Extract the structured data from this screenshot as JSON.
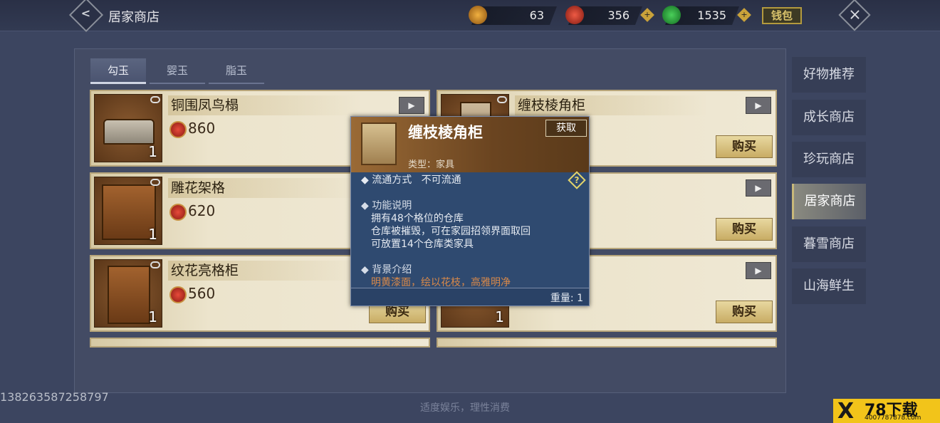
{
  "header": {
    "back_icon": "chevron-left-icon",
    "title": "居家商店",
    "currencies": [
      {
        "name": "gouyu",
        "icon": "gouyu-coin-icon",
        "value": "63",
        "color": "#c98a2a"
      },
      {
        "name": "yingyu",
        "icon": "red-jade-icon",
        "value": "356",
        "color": "#d24a3a"
      },
      {
        "name": "zhiyu",
        "icon": "green-jade-icon",
        "value": "1535",
        "color": "#3aa84a"
      }
    ],
    "wallet_label": "钱包",
    "close_icon": "close-icon"
  },
  "tabs": [
    {
      "label": "勾玉",
      "active": true
    },
    {
      "label": "婴玉",
      "active": false
    },
    {
      "label": "脂玉",
      "active": false
    }
  ],
  "items": [
    {
      "name": "铜围凤鸟榻",
      "price": "860",
      "count": "1",
      "buy_label": "购买"
    },
    {
      "name": "缠枝棱角柜",
      "price": "",
      "count": "",
      "buy_label": "购买"
    },
    {
      "name": "雕花架格",
      "price": "620",
      "count": "1",
      "buy_label": "购买"
    },
    {
      "name": "",
      "price": "",
      "count": "",
      "buy_label": "购买"
    },
    {
      "name": "纹花亮格柜",
      "price": "560",
      "count": "1",
      "buy_label": "购买"
    },
    {
      "name": "",
      "price": "",
      "count": "1",
      "buy_label": "购买"
    }
  ],
  "sidebar": [
    {
      "label": "好物推荐",
      "active": false
    },
    {
      "label": "成长商店",
      "active": false
    },
    {
      "label": "珍玩商店",
      "active": false
    },
    {
      "label": "居家商店",
      "active": true
    },
    {
      "label": "暮雪商店",
      "active": false
    },
    {
      "label": "山海鲜生",
      "active": false
    }
  ],
  "popup": {
    "title": "缠枝棱角柜",
    "get_label": "获取",
    "type_text": "类型：家具",
    "circulation_label": "流通方式",
    "circulation_value": "不可流通",
    "func_heading": "功能说明",
    "func_lines": [
      "拥有48个格位的仓库",
      "仓库被摧毁，可在家园招领界面取回",
      "可放置14个仓库类家具"
    ],
    "bg_heading": "背景介绍",
    "bg_text": "明黄漆面，绘以花枝，高雅明净",
    "weight": "重量: 1"
  },
  "footer": {
    "id_number": "138263587258797",
    "notice": "适度娱乐，理性消费",
    "watermark_main": "78下载",
    "watermark_url": "4007787878.com"
  }
}
